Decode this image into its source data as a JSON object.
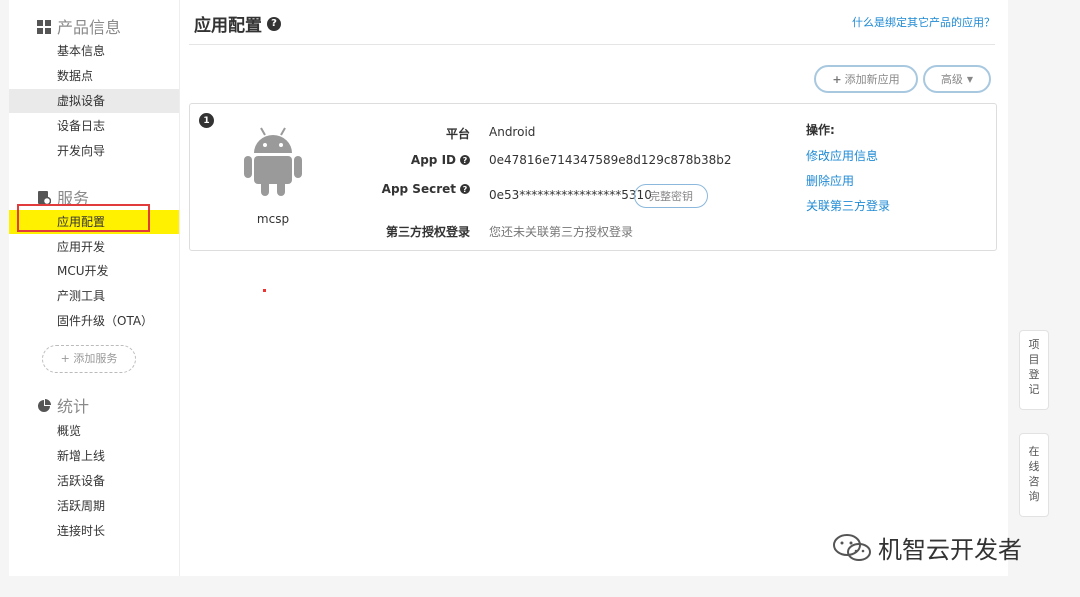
{
  "sidebar": {
    "product_section": {
      "label": "产品信息",
      "items": [
        "基本信息",
        "数据点",
        "虚拟设备",
        "设备日志",
        "开发向导"
      ]
    },
    "service_section": {
      "label": "服务",
      "items": [
        "应用配置",
        "应用开发",
        "MCU开发",
        "产测工具",
        "固件升级（OTA）"
      ],
      "add_service": "+ 添加服务"
    },
    "stats_section": {
      "label": "统计",
      "items": [
        "概览",
        "新增上线",
        "活跃设备",
        "活跃周期",
        "连接时长"
      ]
    }
  },
  "header": {
    "title": "应用配置",
    "help_link": "什么是绑定其它产品的应用？",
    "add_app_button": "添加新应用",
    "advanced_button": "高级"
  },
  "app_card": {
    "index": "1",
    "app_name": "mcsp",
    "fields": {
      "platform_label": "平台",
      "platform_value": "Android",
      "app_id_label": "App ID",
      "app_id_value": "0e47816e714347589e8d129c878b38b2",
      "app_secret_label": "App Secret",
      "app_secret_value": "0e53*****************5310",
      "full_key_button": "完整密钥",
      "third_party_label": "第三方授权登录",
      "third_party_value": "您还未关联第三方授权登录"
    },
    "operations": {
      "title": "操作:",
      "links": [
        "修改应用信息",
        "删除应用",
        "关联第三方登录"
      ]
    }
  },
  "floating": {
    "register": "项目登记",
    "consult": "在线咨询"
  },
  "watermark": "机智云开发者",
  "colors": {
    "link": "#1f8ad4",
    "highlight": "#fff100",
    "annotation": "#e23b3b"
  },
  "icons": [
    "grid-icon",
    "service-icon",
    "pie-chart-icon",
    "question-circle-icon",
    "plus-icon",
    "caret-down-icon",
    "android-icon",
    "wechat-icon"
  ]
}
